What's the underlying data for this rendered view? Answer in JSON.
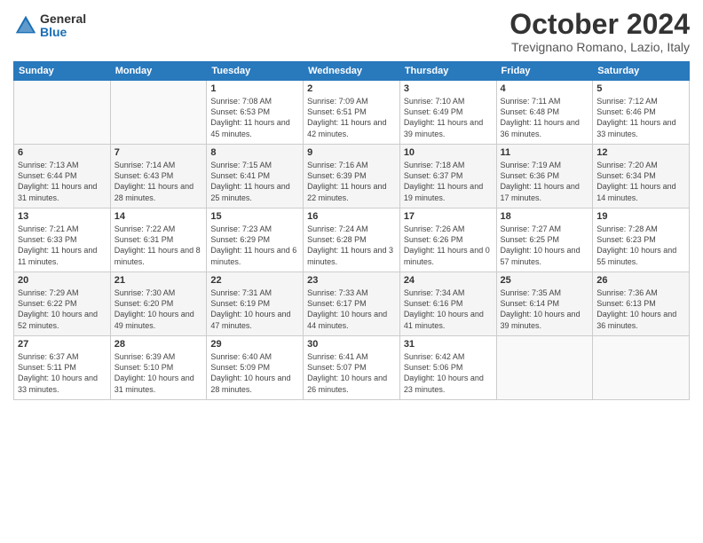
{
  "logo": {
    "general": "General",
    "blue": "Blue"
  },
  "title": "October 2024",
  "location": "Trevignano Romano, Lazio, Italy",
  "days_of_week": [
    "Sunday",
    "Monday",
    "Tuesday",
    "Wednesday",
    "Thursday",
    "Friday",
    "Saturday"
  ],
  "weeks": [
    [
      {
        "day": "",
        "info": ""
      },
      {
        "day": "",
        "info": ""
      },
      {
        "day": "1",
        "info": "Sunrise: 7:08 AM\nSunset: 6:53 PM\nDaylight: 11 hours and 45 minutes."
      },
      {
        "day": "2",
        "info": "Sunrise: 7:09 AM\nSunset: 6:51 PM\nDaylight: 11 hours and 42 minutes."
      },
      {
        "day": "3",
        "info": "Sunrise: 7:10 AM\nSunset: 6:49 PM\nDaylight: 11 hours and 39 minutes."
      },
      {
        "day": "4",
        "info": "Sunrise: 7:11 AM\nSunset: 6:48 PM\nDaylight: 11 hours and 36 minutes."
      },
      {
        "day": "5",
        "info": "Sunrise: 7:12 AM\nSunset: 6:46 PM\nDaylight: 11 hours and 33 minutes."
      }
    ],
    [
      {
        "day": "6",
        "info": "Sunrise: 7:13 AM\nSunset: 6:44 PM\nDaylight: 11 hours and 31 minutes."
      },
      {
        "day": "7",
        "info": "Sunrise: 7:14 AM\nSunset: 6:43 PM\nDaylight: 11 hours and 28 minutes."
      },
      {
        "day": "8",
        "info": "Sunrise: 7:15 AM\nSunset: 6:41 PM\nDaylight: 11 hours and 25 minutes."
      },
      {
        "day": "9",
        "info": "Sunrise: 7:16 AM\nSunset: 6:39 PM\nDaylight: 11 hours and 22 minutes."
      },
      {
        "day": "10",
        "info": "Sunrise: 7:18 AM\nSunset: 6:37 PM\nDaylight: 11 hours and 19 minutes."
      },
      {
        "day": "11",
        "info": "Sunrise: 7:19 AM\nSunset: 6:36 PM\nDaylight: 11 hours and 17 minutes."
      },
      {
        "day": "12",
        "info": "Sunrise: 7:20 AM\nSunset: 6:34 PM\nDaylight: 11 hours and 14 minutes."
      }
    ],
    [
      {
        "day": "13",
        "info": "Sunrise: 7:21 AM\nSunset: 6:33 PM\nDaylight: 11 hours and 11 minutes."
      },
      {
        "day": "14",
        "info": "Sunrise: 7:22 AM\nSunset: 6:31 PM\nDaylight: 11 hours and 8 minutes."
      },
      {
        "day": "15",
        "info": "Sunrise: 7:23 AM\nSunset: 6:29 PM\nDaylight: 11 hours and 6 minutes."
      },
      {
        "day": "16",
        "info": "Sunrise: 7:24 AM\nSunset: 6:28 PM\nDaylight: 11 hours and 3 minutes."
      },
      {
        "day": "17",
        "info": "Sunrise: 7:26 AM\nSunset: 6:26 PM\nDaylight: 11 hours and 0 minutes."
      },
      {
        "day": "18",
        "info": "Sunrise: 7:27 AM\nSunset: 6:25 PM\nDaylight: 10 hours and 57 minutes."
      },
      {
        "day": "19",
        "info": "Sunrise: 7:28 AM\nSunset: 6:23 PM\nDaylight: 10 hours and 55 minutes."
      }
    ],
    [
      {
        "day": "20",
        "info": "Sunrise: 7:29 AM\nSunset: 6:22 PM\nDaylight: 10 hours and 52 minutes."
      },
      {
        "day": "21",
        "info": "Sunrise: 7:30 AM\nSunset: 6:20 PM\nDaylight: 10 hours and 49 minutes."
      },
      {
        "day": "22",
        "info": "Sunrise: 7:31 AM\nSunset: 6:19 PM\nDaylight: 10 hours and 47 minutes."
      },
      {
        "day": "23",
        "info": "Sunrise: 7:33 AM\nSunset: 6:17 PM\nDaylight: 10 hours and 44 minutes."
      },
      {
        "day": "24",
        "info": "Sunrise: 7:34 AM\nSunset: 6:16 PM\nDaylight: 10 hours and 41 minutes."
      },
      {
        "day": "25",
        "info": "Sunrise: 7:35 AM\nSunset: 6:14 PM\nDaylight: 10 hours and 39 minutes."
      },
      {
        "day": "26",
        "info": "Sunrise: 7:36 AM\nSunset: 6:13 PM\nDaylight: 10 hours and 36 minutes."
      }
    ],
    [
      {
        "day": "27",
        "info": "Sunrise: 6:37 AM\nSunset: 5:11 PM\nDaylight: 10 hours and 33 minutes."
      },
      {
        "day": "28",
        "info": "Sunrise: 6:39 AM\nSunset: 5:10 PM\nDaylight: 10 hours and 31 minutes."
      },
      {
        "day": "29",
        "info": "Sunrise: 6:40 AM\nSunset: 5:09 PM\nDaylight: 10 hours and 28 minutes."
      },
      {
        "day": "30",
        "info": "Sunrise: 6:41 AM\nSunset: 5:07 PM\nDaylight: 10 hours and 26 minutes."
      },
      {
        "day": "31",
        "info": "Sunrise: 6:42 AM\nSunset: 5:06 PM\nDaylight: 10 hours and 23 minutes."
      },
      {
        "day": "",
        "info": ""
      },
      {
        "day": "",
        "info": ""
      }
    ]
  ]
}
